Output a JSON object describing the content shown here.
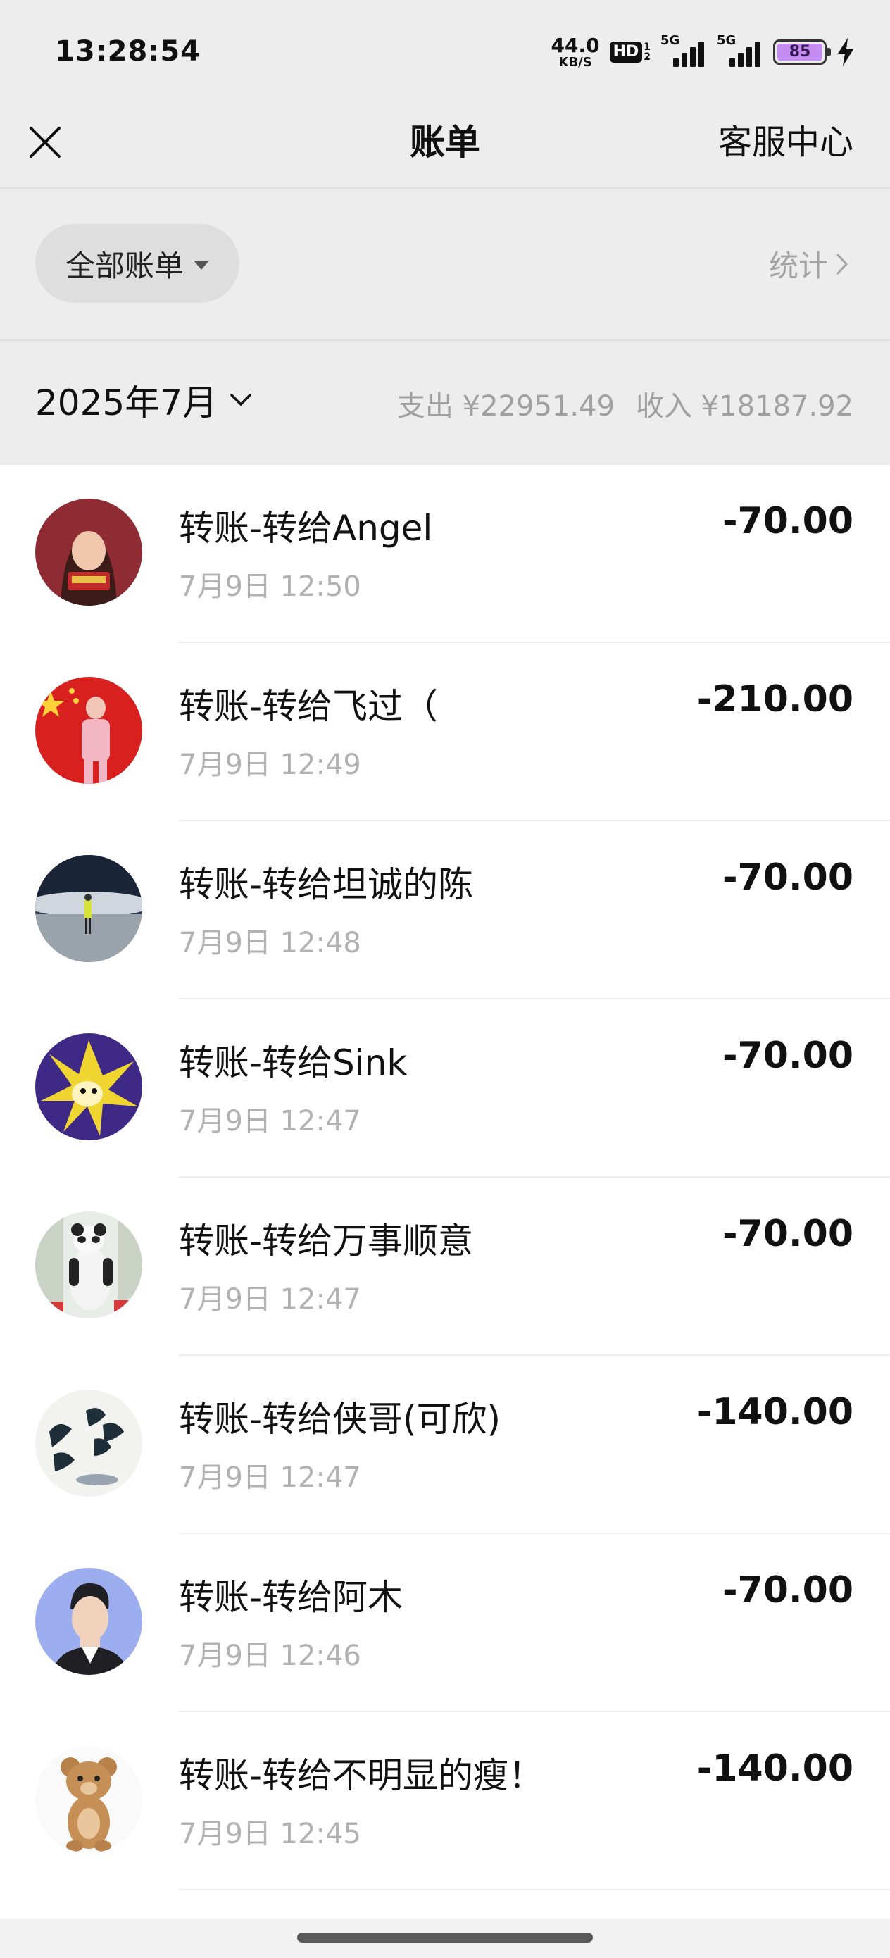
{
  "status_bar": {
    "time": "13:28:54",
    "net_speed": "44.0",
    "net_speed_unit": "KB/S",
    "hd_label": "HD",
    "sim_slots": [
      "1",
      "2"
    ],
    "signal_label": "5G",
    "battery_percent": "85",
    "charging": true
  },
  "nav": {
    "title": "账单",
    "right_link": "客服中心"
  },
  "filter": {
    "label": "全部账单",
    "stats_label": "统计"
  },
  "month": {
    "label": "2025年7月",
    "expense": "支出 ¥22951.49",
    "income": "收入 ¥18187.92"
  },
  "transactions": [
    {
      "title": "转账-转给Angel",
      "time": "7月9日 12:50",
      "amount": "-70.00"
    },
    {
      "title": "转账-转给飞过（",
      "time": "7月9日 12:49",
      "amount": "-210.00"
    },
    {
      "title": "转账-转给坦诚的陈",
      "time": "7月9日 12:48",
      "amount": "-70.00"
    },
    {
      "title": "转账-转给Sink",
      "time": "7月9日 12:47",
      "amount": "-70.00"
    },
    {
      "title": "转账-转给万事顺意",
      "time": "7月9日 12:47",
      "amount": "-70.00"
    },
    {
      "title": "转账-转给侠哥(可欣)",
      "time": "7月9日 12:47",
      "amount": "-140.00"
    },
    {
      "title": "转账-转给阿木",
      "time": "7月9日 12:46",
      "amount": "-70.00"
    },
    {
      "title": "转账-转给不明显的瘦！",
      "time": "7月9日 12:45",
      "amount": "-140.00"
    }
  ],
  "colors": {
    "header_bg": "#ededed",
    "list_bg": "#ffffff",
    "muted_text": "#b2b2b2",
    "battery_fill": "#c58cf2"
  }
}
